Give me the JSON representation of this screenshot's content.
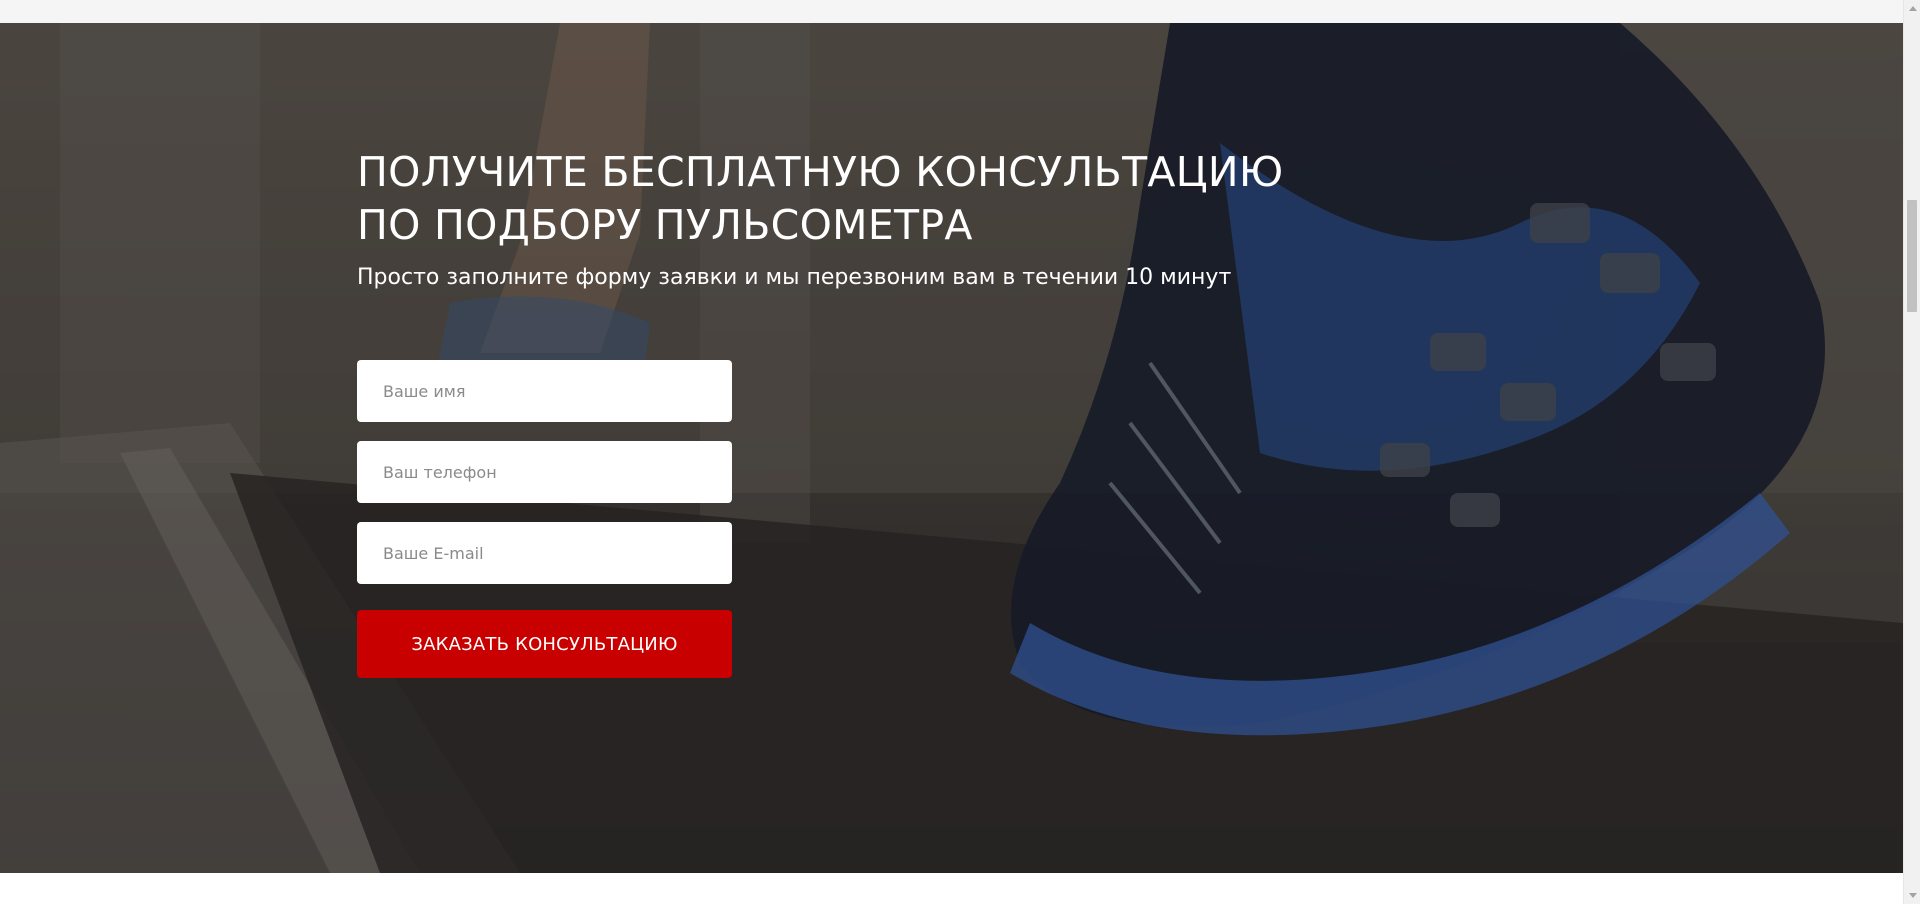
{
  "hero": {
    "title_line1": "ПОЛУЧИТЕ БЕСПЛАТНУЮ КОНСУЛЬТАЦИЮ",
    "title_line2": "ПО ПОДБОРУ ПУЛЬСОМЕТРА",
    "subtitle": "Просто заполните форму заявки и мы перезвоним вам в течении 10 минут"
  },
  "form": {
    "name_placeholder": "Ваше имя",
    "phone_placeholder": "Ваш телефон",
    "email_placeholder": "Ваше E-mail",
    "submit_label": "ЗАКАЗАТЬ КОНСУЛЬТАЦИЮ"
  },
  "colors": {
    "accent": "#c80000",
    "text_light": "#ffffff",
    "field_bg": "#ffffff"
  }
}
